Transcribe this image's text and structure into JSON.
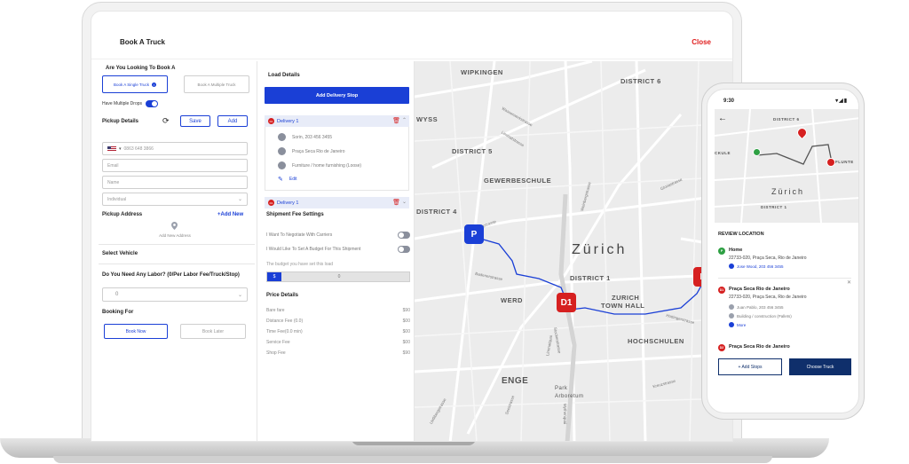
{
  "app": {
    "title": "Book A Truck",
    "close_label": "Close"
  },
  "left": {
    "question": "Are You Looking To Book A",
    "single_truck_label": "Book A Single Truck",
    "multiple_truck_label": "Book A Multiple Truck",
    "multiple_drops_label": "Have Multiple Drops",
    "pickup_details_label": "Pickup Details",
    "save_label": "Save",
    "add_label": "Add",
    "phone_value": "0863 648 3866",
    "email_placeholder": "Email",
    "name_placeholder": "Name",
    "type_value": "Individual",
    "pickup_address_label": "Pickup Address",
    "add_new_label": "+Add New",
    "add_new_address_label": "Add New Address",
    "select_vehicle_label": "Select Vehicle",
    "labor_question": "Do You Need Any Labor? (0/Per Labor Fee/Truck/Stop)",
    "labor_value": "0",
    "booking_for_label": "Booking For",
    "book_now_label": "Book Now",
    "book_later_label": "Book Later"
  },
  "middle": {
    "load_details_label": "Load Details",
    "add_delivery_stop_label": "Add Delivery Stop",
    "deliveries": [
      {
        "badge": "D1",
        "label": "Delivery 1",
        "contact": "Sorin, 203 456 3455",
        "address": "Praça Seca Rio de Janeiro",
        "goods": "Furniture / home furnishing (Loose)",
        "edit_label": "Edit"
      },
      {
        "badge": "D1",
        "label": "Delivery 1"
      }
    ],
    "shipment_fee_label": "Shipment Fee Settings",
    "negotiate_label": "I Want To Negotiate With Carriers",
    "budget_toggle_label": "I Would Like To Set A Budget For This Shipment",
    "budget_set_label": "The budget you have set this load",
    "budget_currency": "$",
    "budget_value": "0",
    "price_details_label": "Price Details",
    "prices": [
      {
        "label": "Bare fare",
        "amount": "$90"
      },
      {
        "label": "Distance Fee (0.0)",
        "amount": "$00"
      },
      {
        "label": "Time Fee(0.0 min)",
        "amount": "$00"
      },
      {
        "label": "Service Fee",
        "amount": "$00"
      },
      {
        "label": "Shop Fee",
        "amount": "$90"
      }
    ]
  },
  "map": {
    "labels": {
      "wipkingen": "WIPKINGEN",
      "district6": "DISTRICT 6",
      "wyss": "WYSS",
      "district5": "DISTRICT 5",
      "gewerbeschule": "GEWERBESCHULE",
      "district4": "DISTRICT 4",
      "zurich": "Zürich",
      "district1": "DISTRICT 1",
      "werd": "WERD",
      "zurich_town_hall_1": "ZURICH",
      "zurich_town_hall_2": "TOWN HALL",
      "hochschulen": "HOCHSCHULEN",
      "enge": "ENGE",
      "park": "Park",
      "arboretum": "Arboretum"
    },
    "streets": {
      "s1": "Wasserwerkstrasse",
      "s2": "Limmatstrasse",
      "s3": "Langstrasse",
      "s4": "Weinbergstrasse",
      "s5": "Badenerstrasse",
      "s6": "Limmatquai",
      "s7": "Hottingerstrasse",
      "s8": "Stockerstrasse",
      "s9": "Seestrasse",
      "s10": "Kreuzstrasse",
      "s11": "Uetlibergstrasse",
      "s12": "Mythenquai",
      "s13": "Gloriastrasse"
    },
    "marker_pickup": "P",
    "marker_d1": "D1",
    "marker_d_edge": "D"
  },
  "phone": {
    "time": "9:30",
    "status_icons": "▾◢▮",
    "map_labels": {
      "district6": "DISTRICT 6",
      "ckule": "CKULE",
      "zurich": "Zürich",
      "flunte": "FLUNTE",
      "district1": "DISTRICT 1"
    },
    "review_title": "REVIEW LOCATION",
    "stops": [
      {
        "badge": "P",
        "name": "Home",
        "address": "22733-020, Praça Seca, Rio de Janeiro",
        "contact": "Jose Wood, 203 456 3455"
      },
      {
        "badge": "D1",
        "name": "Praça Seca Rio de Janeiro",
        "address": "22733-020, Praça Seca, Rio de Janeiro",
        "contact": "Juan Pablo, 203 456 3455",
        "goods": "Building / construction (Pallets)",
        "more": "More"
      },
      {
        "badge": "D2",
        "name": "Praça Seca Rio de Janeiro"
      }
    ],
    "add_stops_label": "+ Add Stops",
    "choose_truck_label": "Choose Truck"
  },
  "colors": {
    "primary": "#1a3fd6",
    "danger": "#d62020",
    "navy": "#0f2f6b"
  }
}
